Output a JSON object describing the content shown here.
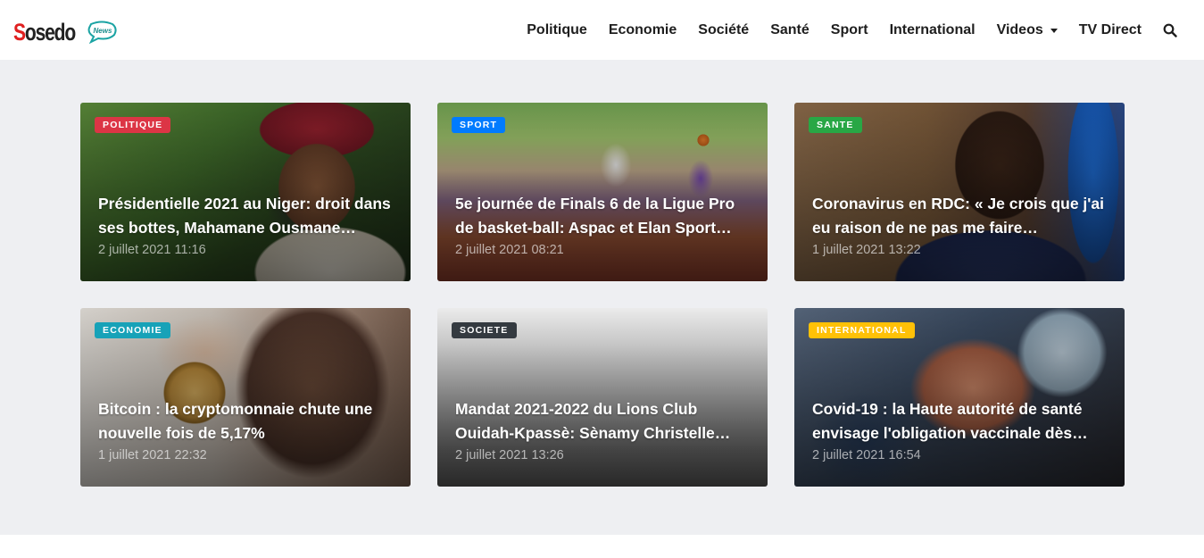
{
  "brand": {
    "name_first": "S",
    "name_rest": "osedo",
    "badge": "News"
  },
  "nav": {
    "items": [
      "Politique",
      "Economie",
      "Société",
      "Santé",
      "Sport",
      "International"
    ],
    "videos": "Videos",
    "tv": "TV Direct"
  },
  "cards": [
    {
      "category": "POLITIQUE",
      "color": "#dc3545",
      "title": "Présidentielle 2021 au Niger: droit dans ses bottes, Mahamane Ousmane…",
      "date": "2 juillet 2021 11:16"
    },
    {
      "category": "SPORT",
      "color": "#007bff",
      "title": "5e journée de Finals 6 de la Ligue Pro de basket-ball: Aspac et Elan Sport…",
      "date": "2 juillet 2021 08:21"
    },
    {
      "category": "SANTE",
      "color": "#28a745",
      "title": "Coronavirus en RDC: « Je crois que j'ai eu raison de ne pas me faire…",
      "date": "1 juillet 2021 13:22"
    },
    {
      "category": "ECONOMIE",
      "color": "#17a2b8",
      "title": "Bitcoin : la cryptomonnaie chute une nouvelle fois de 5,17%",
      "date": "1 juillet 2021 22:32"
    },
    {
      "category": "SOCIETE",
      "color": "#343a40",
      "title": "Mandat 2021-2022 du Lions Club Ouidah-Kpassè: Sènamy Christelle…",
      "date": "2 juillet 2021 13:26"
    },
    {
      "category": "INTERNATIONAL",
      "color": "#ffc107",
      "title": "Covid-19 : la Haute autorité de santé envisage l'obligation vaccinale dès…",
      "date": "2 juillet 2021 16:54"
    }
  ]
}
